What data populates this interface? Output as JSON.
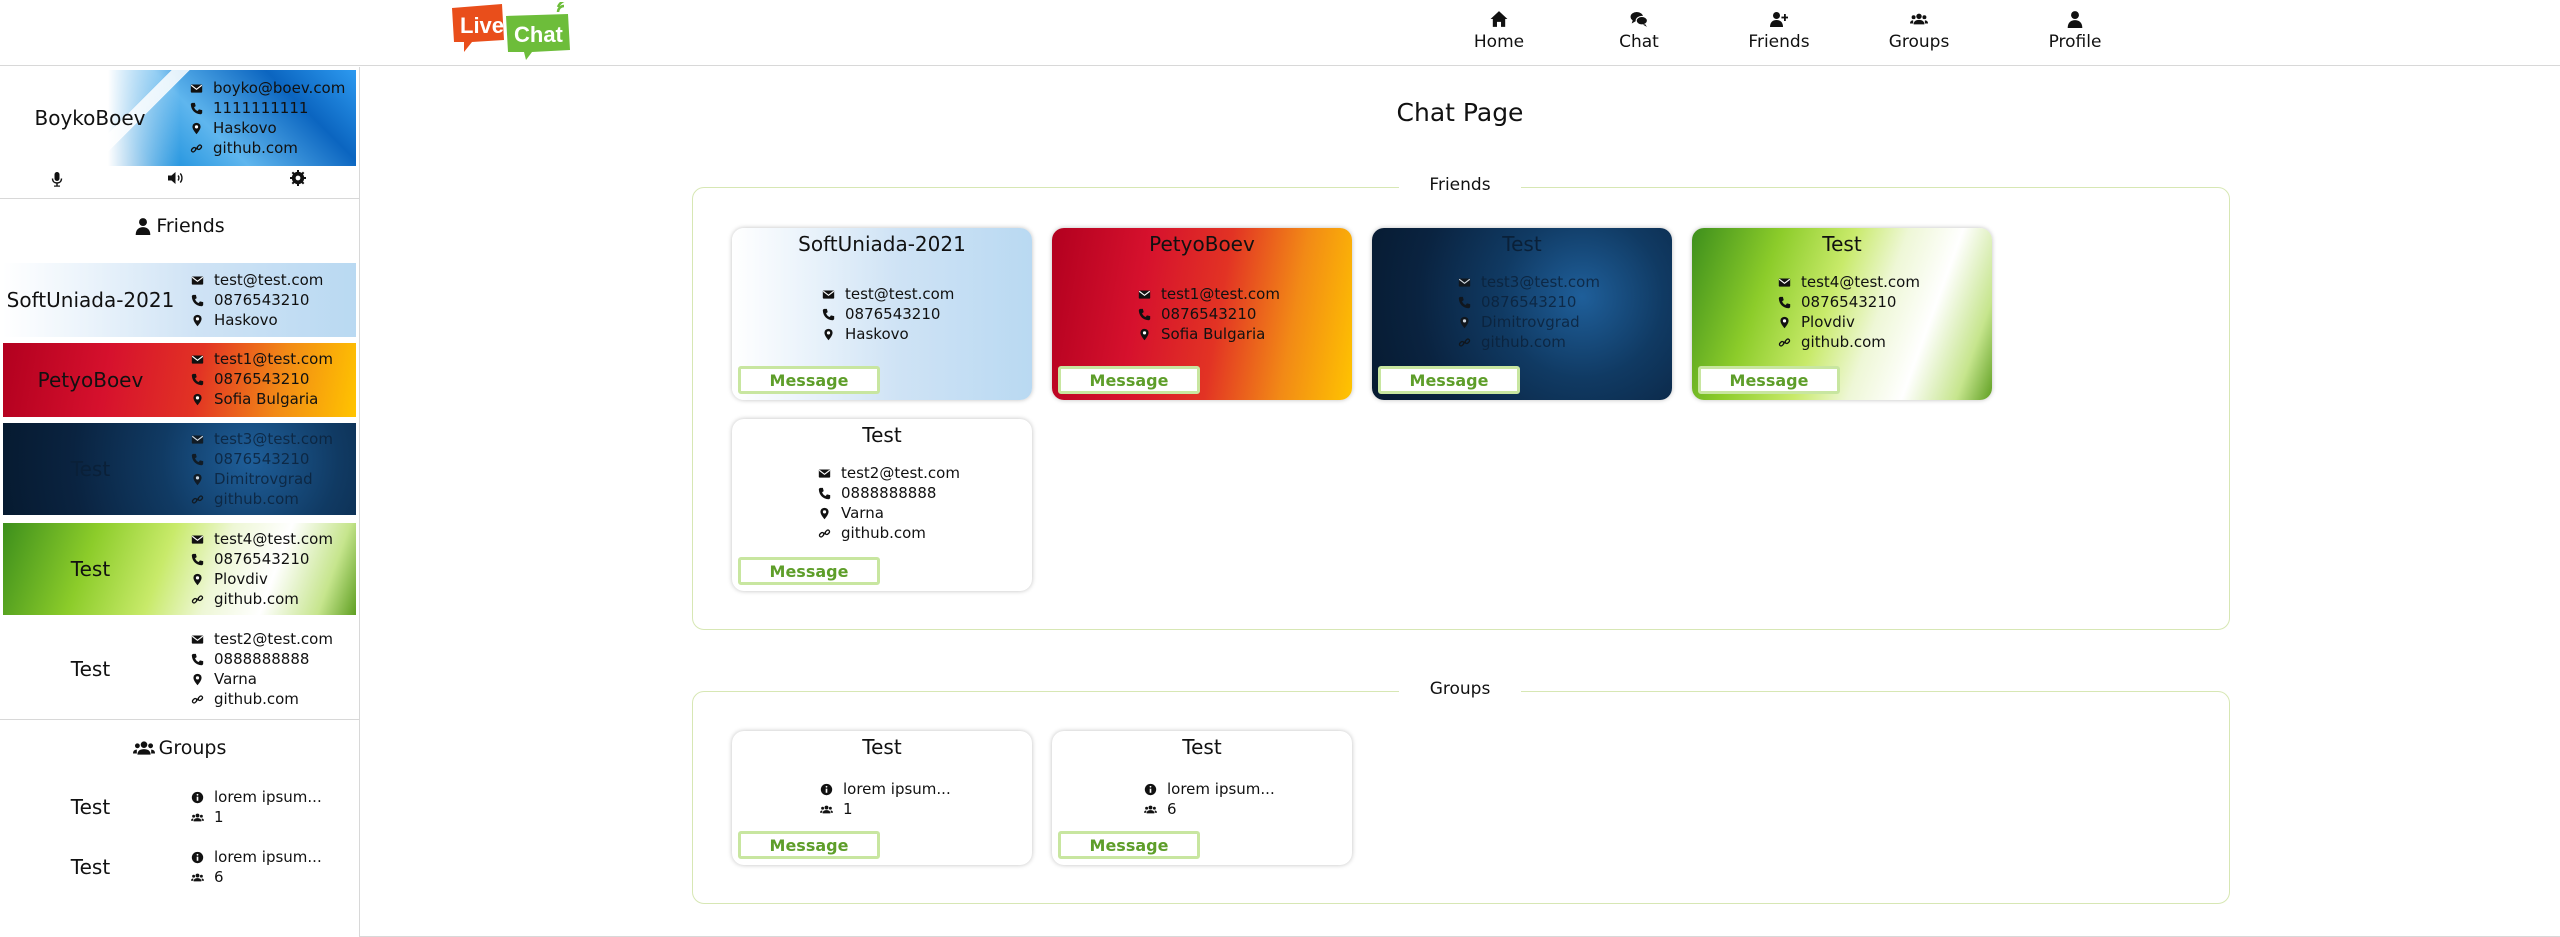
{
  "app": {
    "logo_text_1": "Live",
    "logo_text_2": "Chat"
  },
  "nav": [
    {
      "label": "Home",
      "icon": "home-icon"
    },
    {
      "label": "Chat",
      "icon": "chat-icon"
    },
    {
      "label": "Friends",
      "icon": "add-friend-icon"
    },
    {
      "label": "Groups",
      "icon": "groups-icon"
    },
    {
      "label": "Profile",
      "icon": "user-icon"
    }
  ],
  "profile": {
    "name": "BoykoBoev",
    "email": "boyko@boev.com",
    "phone": "1111111111",
    "location": "Haskovo",
    "link": "github.com"
  },
  "sidebar": {
    "friends_heading": "Friends",
    "groups_heading": "Groups",
    "friends": [
      {
        "name": "SoftUniada-2021",
        "email": "test@test.com",
        "phone": "0876543210",
        "location": "Haskovo"
      },
      {
        "name": "PetyoBoev",
        "email": "test1@test.com",
        "phone": "0876543210",
        "location": "Sofia Bulgaria"
      },
      {
        "name": "Test",
        "email": "test3@test.com",
        "phone": "0876543210",
        "location": "Dimitrovgrad",
        "link": "github.com"
      },
      {
        "name": "Test",
        "email": "test4@test.com",
        "phone": "0876543210",
        "location": "Plovdiv",
        "link": "github.com"
      },
      {
        "name": "Test",
        "email": "test2@test.com",
        "phone": "0888888888",
        "location": "Varna",
        "link": "github.com"
      }
    ],
    "groups": [
      {
        "name": "Test",
        "description": "lorem ipsum...",
        "members": "1"
      },
      {
        "name": "Test",
        "description": "lorem ipsum...",
        "members": "6"
      }
    ]
  },
  "main": {
    "title": "Chat Page",
    "friends_section_label": "Friends",
    "groups_section_label": "Groups",
    "message_label": "Message",
    "friend_cards": [
      {
        "name": "SoftUniada-2021",
        "email": "test@test.com",
        "phone": "0876543210",
        "location": "Haskovo"
      },
      {
        "name": "PetyoBoev",
        "email": "test1@test.com",
        "phone": "0876543210",
        "location": "Sofia Bulgaria"
      },
      {
        "name": "Test",
        "email": "test3@test.com",
        "phone": "0876543210",
        "location": "Dimitrovgrad",
        "link": "github.com"
      },
      {
        "name": "Test",
        "email": "test4@test.com",
        "phone": "0876543210",
        "location": "Plovdiv",
        "link": "github.com"
      },
      {
        "name": "Test",
        "email": "test2@test.com",
        "phone": "0888888888",
        "location": "Varna",
        "link": "github.com"
      }
    ],
    "group_cards": [
      {
        "name": "Test",
        "description": "lorem ipsum...",
        "members": "1"
      },
      {
        "name": "Test",
        "description": "lorem ipsum...",
        "members": "6"
      }
    ]
  },
  "colors": {
    "accent_green": "#5e9e2a",
    "button_border": "#c8e6a0",
    "section_border": "#d7e7b4"
  }
}
